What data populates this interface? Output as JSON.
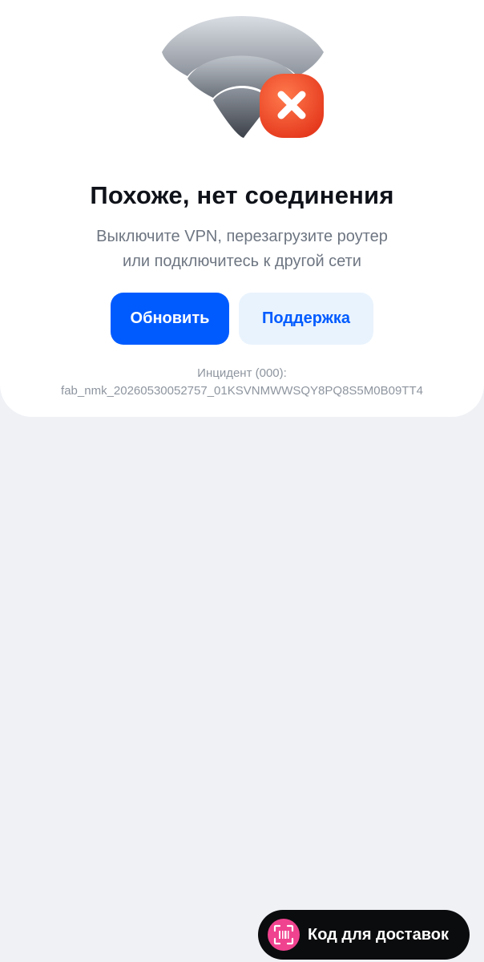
{
  "error": {
    "illustration": "wifi-error-icon",
    "title": "Похоже, нет соединения",
    "subtitle_line1": "Выключите VPN, перезагрузите роутер",
    "subtitle_line2": "или подключитесь к другой сети",
    "refresh_label": "Обновить",
    "support_label": "Поддержка",
    "incident_label": "Инцидент (000):",
    "incident_id": "fab_nmk_20260530052757_01KSVNMWWSQY8PQ8S5M0B09TT4"
  },
  "fab": {
    "icon": "barcode-scan-icon",
    "label": "Код для доставок"
  },
  "colors": {
    "primary": "#005bff",
    "secondary_bg": "#e9f3fd",
    "error_badge": "#f0502c",
    "fab_bg": "#0b0c0e",
    "fab_icon_bg": "#f0438f",
    "page_bg": "#eff1f5"
  }
}
